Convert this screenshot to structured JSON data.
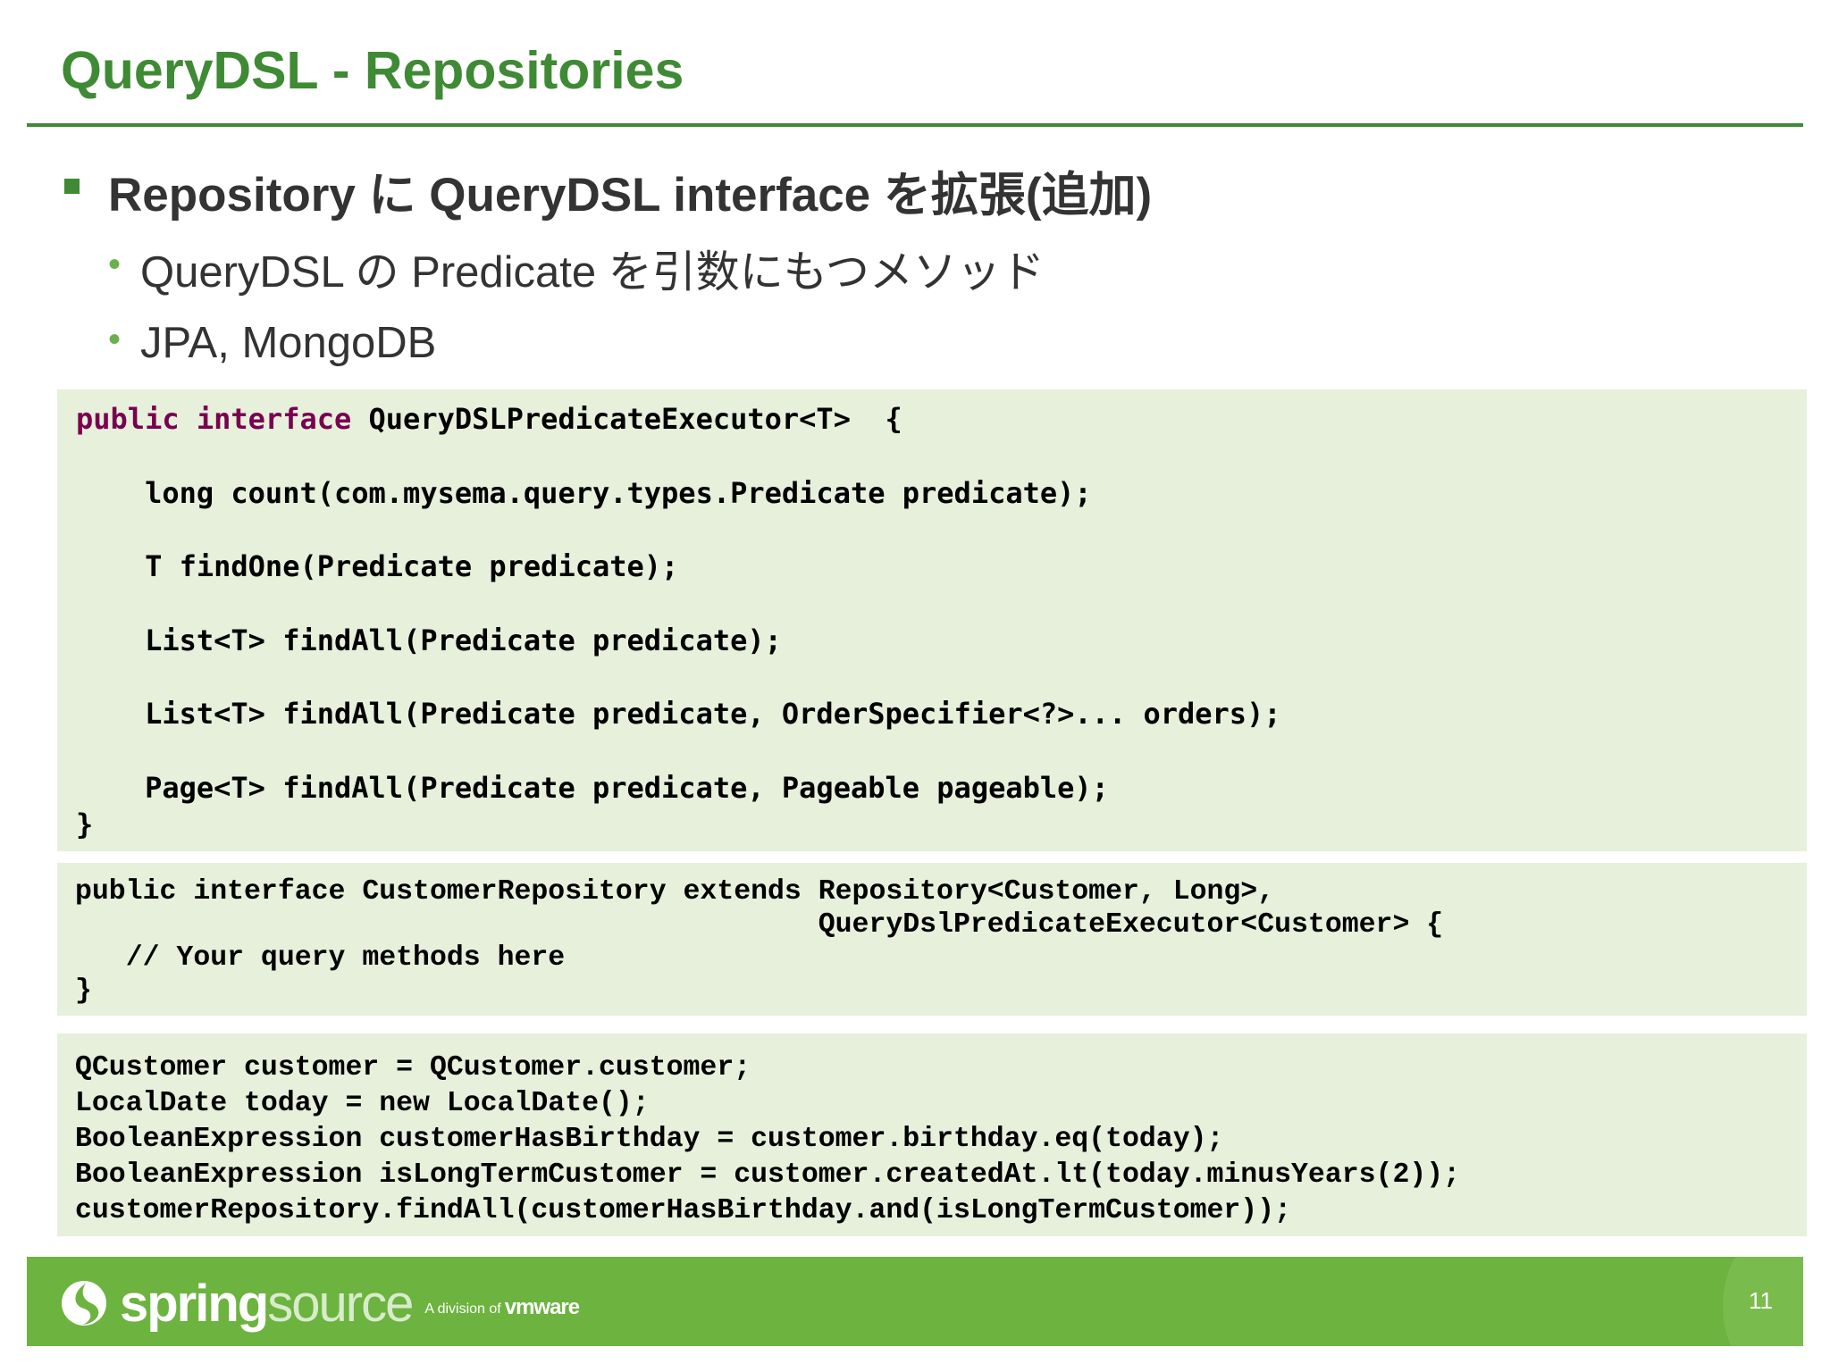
{
  "slide": {
    "title": "QueryDSL - Repositories",
    "bullet": "Repository に QueryDSL interface を拡張(追加)",
    "sub_bullets": [
      "QueryDSL の Predicate を引数にもつメソッド",
      "JPA, MongoDB"
    ]
  },
  "code_blocks": {
    "executor": {
      "kw_public": "public",
      "kw_interface": "interface",
      "signature": " QueryDSLPredicateExecutor<T>  {",
      "methods": [
        "    long count(com.mysema.query.types.Predicate predicate);",
        "    T findOne(Predicate predicate);",
        "    List<T> findAll(Predicate predicate);",
        "    List<T> findAll(Predicate predicate, OrderSpecifier<?>... orders);",
        "    Page<T> findAll(Predicate predicate, Pageable pageable);"
      ],
      "close": "}"
    },
    "repository": {
      "lines": [
        "public interface CustomerRepository extends Repository<Customer, Long>,",
        "                                            QueryDslPredicateExecutor<Customer> {",
        "   // Your query methods here",
        "}"
      ]
    },
    "usage": {
      "lines": [
        "QCustomer customer = QCustomer.customer;",
        "LocalDate today = new LocalDate();",
        "BooleanExpression customerHasBirthday = customer.birthday.eq(today);",
        "BooleanExpression isLongTermCustomer = customer.createdAt.lt(today.minusYears(2));",
        "customerRepository.findAll(customerHasBirthday.and(isLongTermCustomer));"
      ]
    }
  },
  "footer": {
    "logo_spring": "spring",
    "logo_source": "source",
    "logo_division": "A division of",
    "logo_vmware": "vmware",
    "page_number": "11",
    "icon": "spring-leaf-icon",
    "bar_color": "#6cb33f"
  },
  "colors": {
    "title_green": "#3f8a34",
    "code_background": "#e6f0db",
    "keyword_purple": "#7a0050"
  }
}
